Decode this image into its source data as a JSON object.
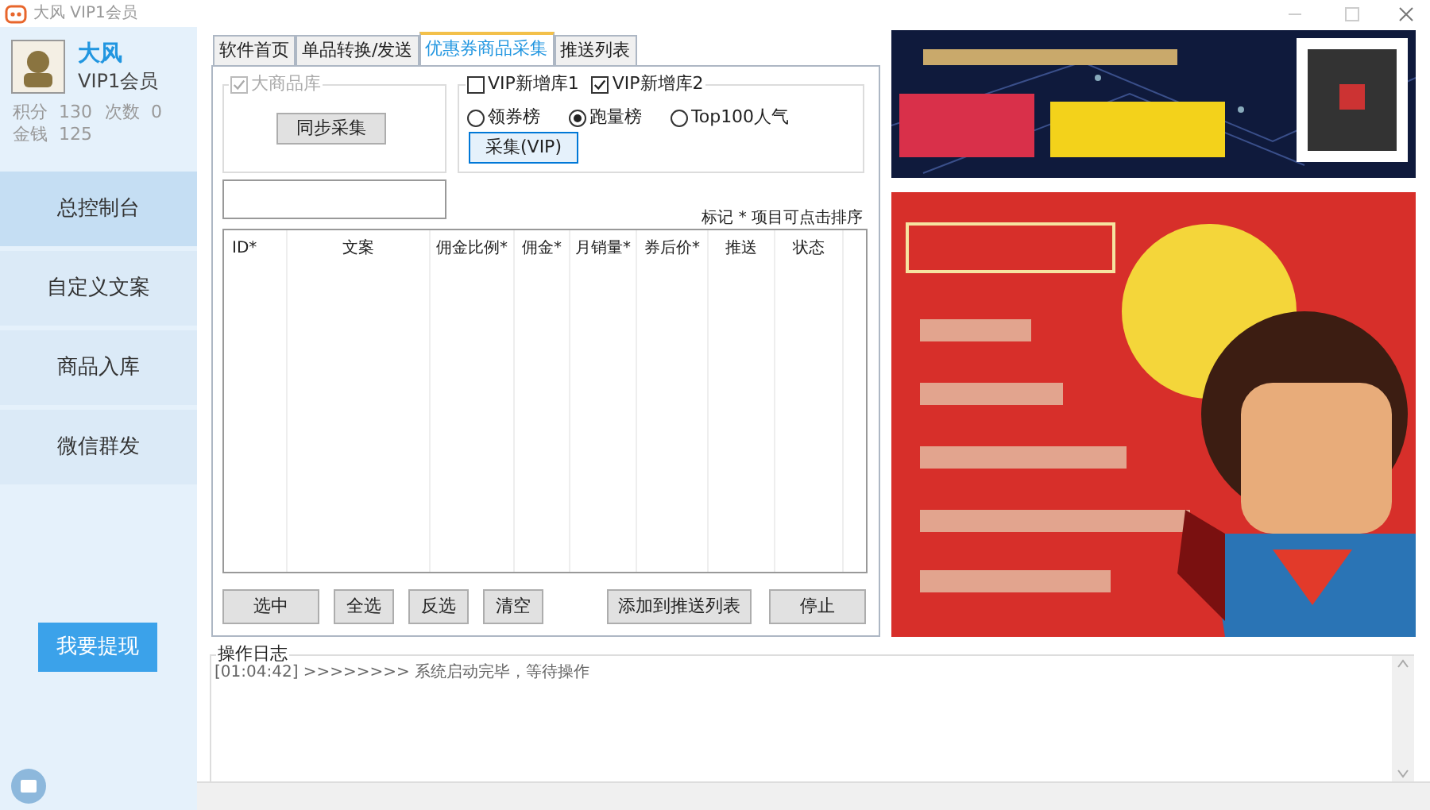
{
  "window": {
    "title": "大风 VIP1会员"
  },
  "profile": {
    "name": "大风",
    "level": "VIP1会员",
    "stats": [
      {
        "label": "积分",
        "value": "130"
      },
      {
        "label": "次数",
        "value": "0"
      },
      {
        "label": "金钱",
        "value": "125"
      }
    ]
  },
  "sidebar": {
    "items": [
      {
        "label": "总控制台",
        "selected": true
      },
      {
        "label": "自定义文案",
        "selected": false
      },
      {
        "label": "商品入库",
        "selected": false
      },
      {
        "label": "微信群发",
        "selected": false
      }
    ],
    "withdraw_button": "我要提现"
  },
  "tabs": [
    {
      "label": "软件首页",
      "selected": false
    },
    {
      "label": "单品转换/发送",
      "selected": false
    },
    {
      "label": "优惠券商品采集",
      "selected": true
    },
    {
      "label": "推送列表",
      "selected": false
    }
  ],
  "big_library": {
    "label": "大商品库",
    "checked": true,
    "disabled": true,
    "button": "同步采集"
  },
  "vip_group": {
    "checkboxes": [
      {
        "label": "VIP新增库1",
        "checked": false
      },
      {
        "label": "VIP新增库2",
        "checked": true
      }
    ],
    "radios": [
      {
        "label": "领券榜",
        "selected": false
      },
      {
        "label": "跑量榜",
        "selected": true
      },
      {
        "label": "Top100人气",
        "selected": false
      }
    ],
    "button": "采集(VIP)"
  },
  "sort_hint": "标记 * 项目可点击排序",
  "table": {
    "columns": [
      "ID*",
      "文案",
      "佣金比例*",
      "佣金*",
      "月销量*",
      "券后价*",
      "推送",
      "状态"
    ]
  },
  "buttons": [
    {
      "label": "选中"
    },
    {
      "label": "全选"
    },
    {
      "label": "反选"
    },
    {
      "label": "清空"
    },
    {
      "label": "添加到推送列表"
    },
    {
      "label": "停止"
    }
  ],
  "log": {
    "title": "操作日志",
    "lines": [
      "[01:04:42] >>>>>>>> 系统启动完毕，等待操作"
    ]
  }
}
